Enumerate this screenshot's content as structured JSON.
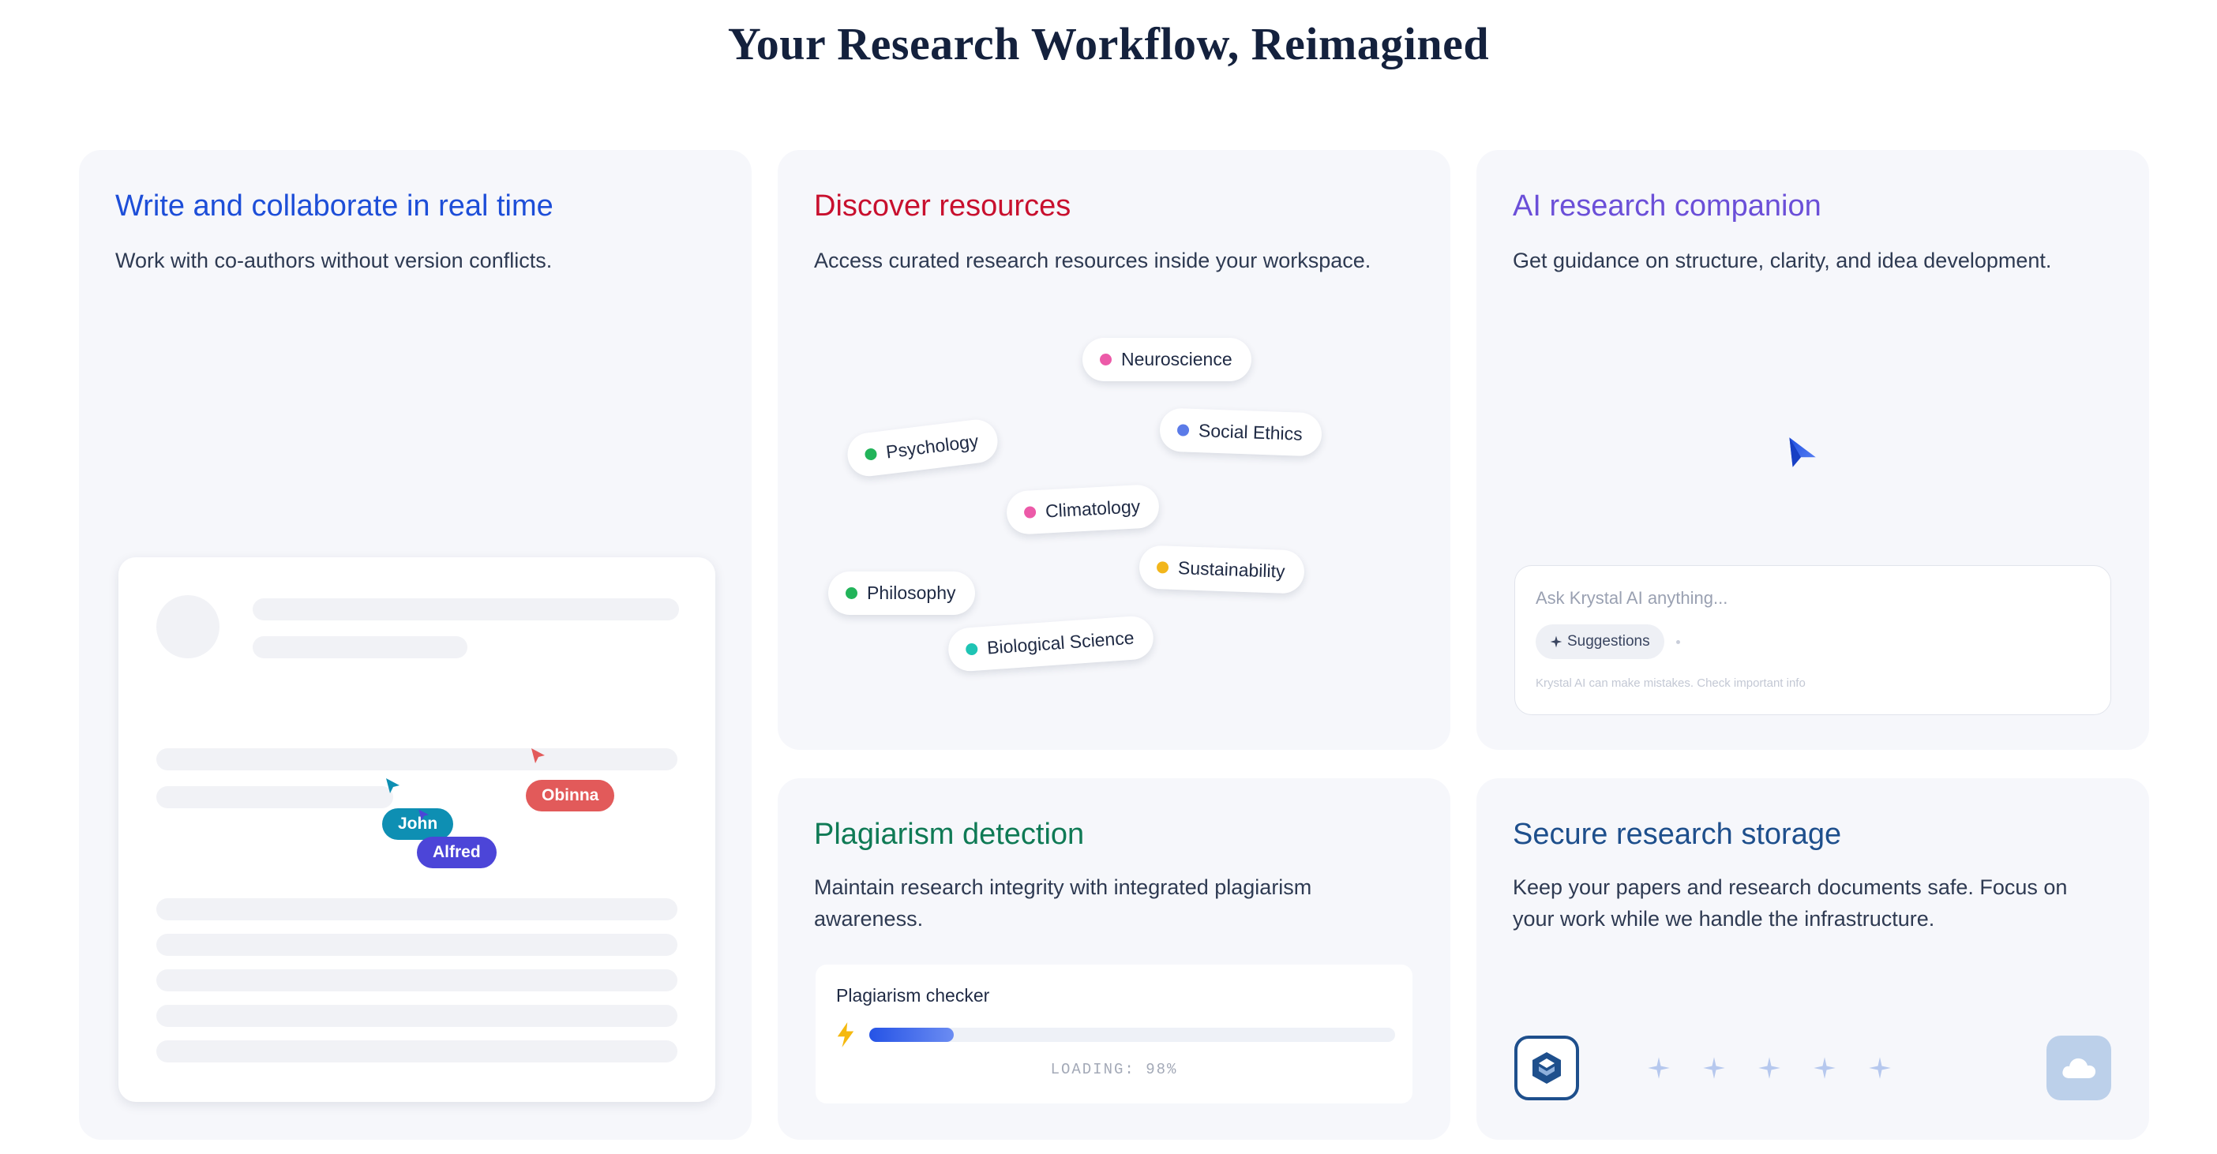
{
  "page": {
    "title": "Your Research Workflow, Reimagined"
  },
  "collab": {
    "title": "Write and collaborate in real time",
    "description": "Work with co-authors without version conflicts.",
    "cursors": [
      {
        "name": "Obinna",
        "color": "#e25a5a"
      },
      {
        "name": "John",
        "color": "#0e8fb3"
      },
      {
        "name": "Alfred",
        "color": "#4c45d8"
      }
    ]
  },
  "discover": {
    "title": "Discover resources",
    "description": "Access curated research resources inside your workspace.",
    "topics": [
      {
        "label": "Neuroscience",
        "dot_color": "#ec5aa8"
      },
      {
        "label": "Social Ethics",
        "dot_color": "#5b7be8"
      },
      {
        "label": "Psychology",
        "dot_color": "#22b45a"
      },
      {
        "label": "Climatology",
        "dot_color": "#ec5aa8"
      },
      {
        "label": "Sustainability",
        "dot_color": "#f2b61c"
      },
      {
        "label": "Philosophy",
        "dot_color": "#22b45a"
      },
      {
        "label": "Biological Science",
        "dot_color": "#1fc4b4"
      }
    ]
  },
  "ai": {
    "title": "AI research companion",
    "description": "Get guidance on structure, clarity, and idea development.",
    "input_placeholder": "Ask Krystal AI anything...",
    "suggestions_label": "Suggestions",
    "disclaimer": "Krystal AI can make mistakes. Check important info"
  },
  "plagiarism": {
    "title": "Plagiarism detection",
    "description": "Maintain research integrity with integrated plagiarism awareness.",
    "checker_title": "Plagiarism checker",
    "progress": 0.16,
    "loading_text": "LOADING: 98%"
  },
  "storage": {
    "title": "Secure research storage",
    "description": "Keep your papers and research documents safe. Focus on your work while we handle the infrastructure."
  },
  "colors": {
    "collab_title": "#1d4ed8",
    "discover_title": "#c8102e",
    "ai_title": "#6b4fd8",
    "plagiarism_title": "#0f7a55",
    "storage_title": "#1e4f8c"
  },
  "icons": [
    "arrow-cursor-icon",
    "paper-plane-icon",
    "sparkle-icon",
    "lightning-icon",
    "app-logo-icon",
    "cloud-icon"
  ]
}
